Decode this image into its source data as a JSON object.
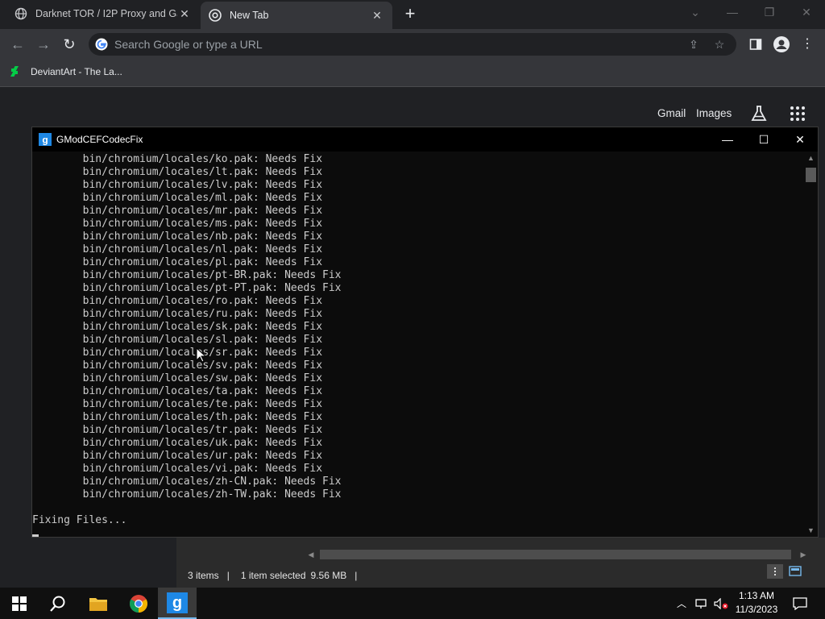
{
  "browser": {
    "tabs": [
      {
        "title": "Darknet TOR / I2P Proxy and Ga",
        "active": false
      },
      {
        "title": "New Tab",
        "active": true
      }
    ],
    "omnibox_placeholder": "Search Google or type a URL",
    "bookmarks": [
      {
        "label": "DeviantArt - The La..."
      }
    ],
    "page_links": {
      "gmail": "Gmail",
      "images": "Images"
    }
  },
  "console": {
    "title": "GModCEFCodecFix",
    "lines": [
      "        bin/chromium/locales/ko.pak: Needs Fix",
      "        bin/chromium/locales/lt.pak: Needs Fix",
      "        bin/chromium/locales/lv.pak: Needs Fix",
      "        bin/chromium/locales/ml.pak: Needs Fix",
      "        bin/chromium/locales/mr.pak: Needs Fix",
      "        bin/chromium/locales/ms.pak: Needs Fix",
      "        bin/chromium/locales/nb.pak: Needs Fix",
      "        bin/chromium/locales/nl.pak: Needs Fix",
      "        bin/chromium/locales/pl.pak: Needs Fix",
      "        bin/chromium/locales/pt-BR.pak: Needs Fix",
      "        bin/chromium/locales/pt-PT.pak: Needs Fix",
      "        bin/chromium/locales/ro.pak: Needs Fix",
      "        bin/chromium/locales/ru.pak: Needs Fix",
      "        bin/chromium/locales/sk.pak: Needs Fix",
      "        bin/chromium/locales/sl.pak: Needs Fix",
      "        bin/chromium/locales/sr.pak: Needs Fix",
      "        bin/chromium/locales/sv.pak: Needs Fix",
      "        bin/chromium/locales/sw.pak: Needs Fix",
      "        bin/chromium/locales/ta.pak: Needs Fix",
      "        bin/chromium/locales/te.pak: Needs Fix",
      "        bin/chromium/locales/th.pak: Needs Fix",
      "        bin/chromium/locales/tr.pak: Needs Fix",
      "        bin/chromium/locales/uk.pak: Needs Fix",
      "        bin/chromium/locales/ur.pak: Needs Fix",
      "        bin/chromium/locales/vi.pak: Needs Fix",
      "        bin/chromium/locales/zh-CN.pak: Needs Fix",
      "        bin/chromium/locales/zh-TW.pak: Needs Fix",
      "",
      "Fixing Files..."
    ]
  },
  "explorer_status": {
    "items": "3 items",
    "selected": "1 item selected",
    "size": "9.56 MB"
  },
  "taskbar": {
    "time": "1:13 AM",
    "date": "11/3/2023"
  },
  "colors": {
    "chrome_dark": "#202124",
    "chrome_toolbar": "#35363a",
    "console_bg": "#0c0c0c",
    "console_text": "#cccccc",
    "taskbar": "#101010"
  }
}
